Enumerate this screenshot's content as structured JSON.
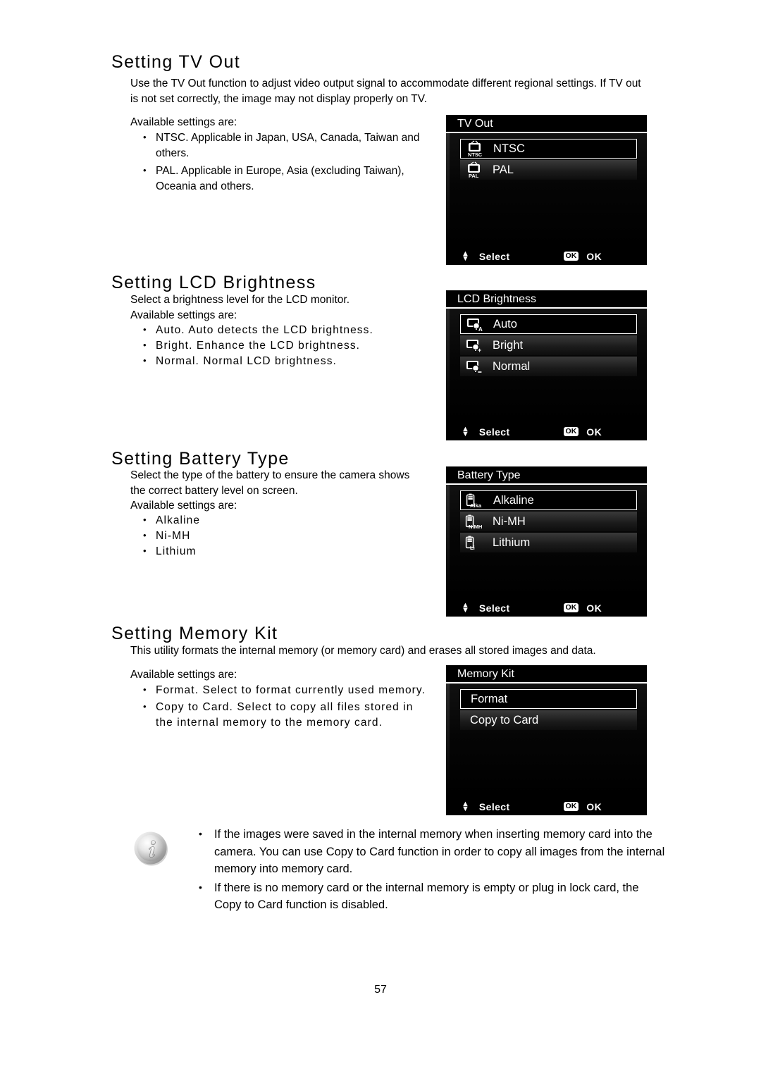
{
  "page": {
    "number": "57"
  },
  "sections": [
    {
      "id": "tv-out",
      "heading": "Setting TV Out",
      "intro": "Use the TV Out function to adjust video output signal to accommodate different regional settings. If TV out is not set correctly, the image may not display properly on TV.",
      "available_label": "Available settings are:",
      "bullets": [
        "NTSC. Applicable in Japan, USA, Canada, Taiwan and others.",
        "PAL. Applicable in Europe, Asia (excluding Taiwan), Oceania and others."
      ]
    },
    {
      "id": "lcd-brightness",
      "heading": "Setting LCD Brightness",
      "intro": "Select a brightness level for the LCD monitor.",
      "available_label": "Available settings are:",
      "bullets": [
        "Auto. Auto detects the LCD brightness.",
        "Bright. Enhance the LCD brightness.",
        "Normal. Normal LCD brightness."
      ]
    },
    {
      "id": "battery-type",
      "heading": "Setting Battery Type",
      "intro": "Select the type of the battery to ensure the camera shows the correct battery level on screen.",
      "available_label": "Available settings are:",
      "bullets": [
        "Alkaline",
        "Ni-MH",
        "Lithium"
      ]
    },
    {
      "id": "memory-kit",
      "heading": "Setting Memory Kit",
      "intro": "This utility formats the internal memory (or memory card) and erases all stored images and data.",
      "available_label": "Available settings are:",
      "bullets": [
        "Format. Select to format currently used memory.",
        "Copy to Card. Select to copy all files stored in the internal memory to the memory card."
      ]
    }
  ],
  "camera_menus": [
    {
      "title": "TV Out",
      "items": [
        {
          "label": "NTSC",
          "icon": "tv-ntsc-icon",
          "icon_text": "NTSC",
          "selected": true
        },
        {
          "label": "PAL",
          "icon": "tv-pal-icon",
          "icon_text": "PAL",
          "selected": false
        }
      ],
      "footer": {
        "select": "Select",
        "ok_badge": "OK",
        "ok": "OK"
      }
    },
    {
      "title": "LCD Brightness",
      "items": [
        {
          "label": "Auto",
          "icon": "lcd-auto-icon",
          "icon_text": "A",
          "selected": true
        },
        {
          "label": "Bright",
          "icon": "lcd-bright-icon",
          "icon_text": "+",
          "selected": false
        },
        {
          "label": "Normal",
          "icon": "lcd-normal-icon",
          "icon_text": "-",
          "selected": false
        }
      ],
      "footer": {
        "select": "Select",
        "ok_badge": "OK",
        "ok": "OK"
      }
    },
    {
      "title": "Battery Type",
      "items": [
        {
          "label": "Alkaline",
          "icon": "battery-alkaline-icon",
          "icon_text": "Alka",
          "selected": true
        },
        {
          "label": "Ni-MH",
          "icon": "battery-nimh-icon",
          "icon_text": "NiMH",
          "selected": false
        },
        {
          "label": "Lithium",
          "icon": "battery-lithium-icon",
          "icon_text": "Li",
          "selected": false
        }
      ],
      "footer": {
        "select": "Select",
        "ok_badge": "OK",
        "ok": "OK"
      }
    },
    {
      "title": "Memory Kit",
      "items": [
        {
          "label": "Format",
          "icon": "",
          "icon_text": "",
          "selected": true
        },
        {
          "label": "Copy to Card",
          "icon": "",
          "icon_text": "",
          "selected": false
        }
      ],
      "footer": {
        "select": "Select",
        "ok_badge": "OK",
        "ok": "OK"
      }
    }
  ],
  "note": {
    "icon": "info-icon",
    "bullets": [
      "If the images were saved in the internal memory when inserting memory card into the camera. You can use Copy to Card function in order to copy all images from the internal memory into memory card.",
      "If there is no memory card or the internal memory is empty or plug in lock card, the Copy to Card function is disabled."
    ]
  },
  "colors": {
    "panel_bg": "#000000",
    "panel_text": "#ffffff",
    "page_bg": "#ffffff"
  }
}
